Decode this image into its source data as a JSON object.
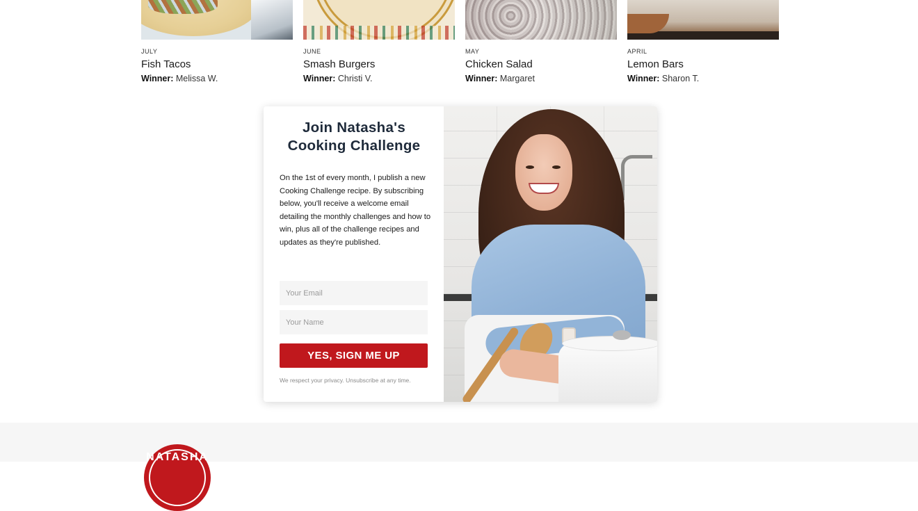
{
  "recipes": [
    {
      "month": "July",
      "title": "Fish Tacos",
      "winner_label": "Winner:",
      "winner_name": " Melissa W."
    },
    {
      "month": "June",
      "title": "Smash Burgers",
      "winner_label": "Winner:",
      "winner_name": " Christi V."
    },
    {
      "month": "May",
      "title": "Chicken Salad",
      "winner_label": "Winner:",
      "winner_name": " Margaret"
    },
    {
      "month": "April",
      "title": "Lemon Bars",
      "winner_label": "Winner:",
      "winner_name": " Sharon T."
    }
  ],
  "signup": {
    "heading": "Join Natasha's Cooking Challenge",
    "description": "On the 1st of every month, I publish a new Cooking Challenge recipe. By subscribing below, you'll receive a welcome email detailing the monthly challenges and how to win, plus all of the challenge recipes and updates as they're published.",
    "email_placeholder": "Your Email",
    "name_placeholder": "Your Name",
    "submit_label": "YES, SIGN ME UP",
    "privacy_note": "We respect your privacy. Unsubscribe at any time."
  },
  "footer": {
    "logo_text": "NATASHA"
  },
  "colors": {
    "accent": "#c0181d",
    "heading": "#1e2a3a",
    "footer_bg": "#f6f6f6"
  }
}
